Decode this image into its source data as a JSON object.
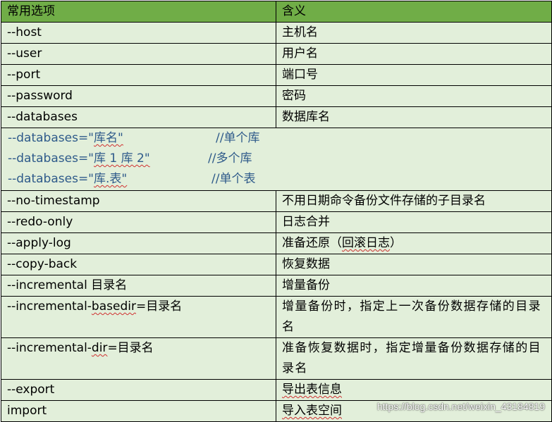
{
  "table": {
    "header": {
      "col1": "常用选项",
      "col2": "含义"
    },
    "rows_top": [
      {
        "option": "--host",
        "meaning": "主机名"
      },
      {
        "option": "--user",
        "meaning": "用户名"
      },
      {
        "option": "--port",
        "meaning": "端口号"
      },
      {
        "option": "--password",
        "meaning": "密码"
      },
      {
        "option": "--databases",
        "meaning": "数据库名"
      }
    ],
    "examples": [
      {
        "option_prefix": "--databases=\"",
        "option_mark": "库名\"",
        "option_suffix": "",
        "comment": "//单个库"
      },
      {
        "option_prefix": "--databases=\"",
        "option_mark": "库 1    库 2\"",
        "option_suffix": "",
        "comment": "//多个库"
      },
      {
        "option_prefix": "--databases=\"",
        "option_mark": "库.表\"",
        "option_suffix": "",
        "comment": "//单个表"
      }
    ],
    "rows_mid": [
      {
        "option": "--no-timestamp",
        "meaning": "不用日期命令备份文件存储的子目录名"
      },
      {
        "option": "--redo-only",
        "meaning": "日志合并"
      },
      {
        "option": "--apply-log",
        "meaning_prefix": "准备还原（",
        "meaning_mark": "回滚日志",
        "meaning_suffix": "）"
      },
      {
        "option": "--copy-back",
        "meaning": "恢复数据"
      },
      {
        "option": "--incremental 目录名",
        "meaning": "增量备份"
      }
    ],
    "rows_tall": [
      {
        "option_prefix": "--incremental-",
        "option_mark": "basedir",
        "option_suffix": "=目录名",
        "meaning": "增量备份时，指定上一次备份数据存储的目录名"
      },
      {
        "option_prefix": "--incremental-",
        "option_mark": "dir",
        "option_suffix": "=目录名",
        "meaning": "准备恢复数据时，指定增量备份数据存储的目录名"
      }
    ],
    "rows_bottom": [
      {
        "option": "--export",
        "meaning_prefix": "",
        "meaning_mark": "导出表信息",
        "meaning_suffix": ""
      },
      {
        "option": "import",
        "meaning_prefix": "",
        "meaning_mark": "导入表空间",
        "meaning_suffix": ""
      }
    ]
  },
  "watermark": "https://blog.csdn.net/weixin_43184819",
  "colors": {
    "header_bg": "#70ad47",
    "row_bg": "#e2efda",
    "example_text": "#2e5a8a",
    "spell_squiggle": "#d03030"
  }
}
